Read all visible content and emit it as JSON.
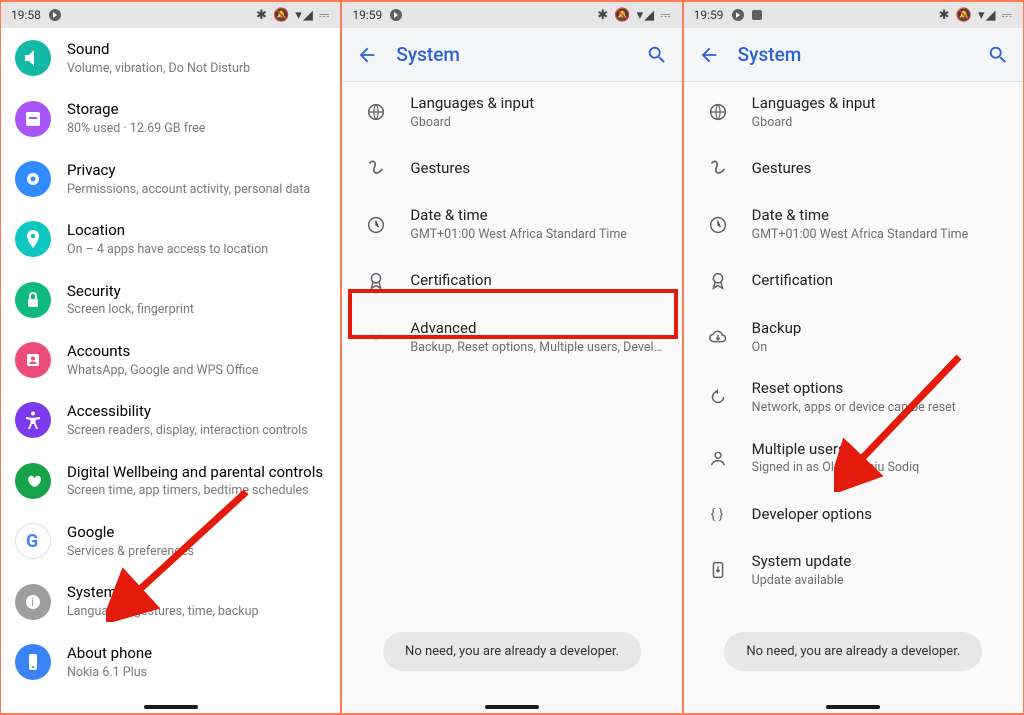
{
  "panel1": {
    "time": "19:58",
    "status_icons": "✱ 🔕 ▾◢ ⏻",
    "items": [
      {
        "key": "sound",
        "title": "Sound",
        "subtitle": "Volume, vibration, Do Not Disturb",
        "color": "#14b8a6",
        "icon": "volume"
      },
      {
        "key": "storage",
        "title": "Storage",
        "subtitle": "80% used · 12.69 GB free",
        "color": "#a855f7",
        "icon": "storage"
      },
      {
        "key": "privacy",
        "title": "Privacy",
        "subtitle": "Permissions, account activity, personal data",
        "color": "#2f8bff",
        "icon": "privacy"
      },
      {
        "key": "location",
        "title": "Location",
        "subtitle": "On – 4 apps have access to location",
        "color": "#0ec7c0",
        "icon": "location"
      },
      {
        "key": "security",
        "title": "Security",
        "subtitle": "Screen lock, fingerprint",
        "color": "#10b981",
        "icon": "lock"
      },
      {
        "key": "accounts",
        "title": "Accounts",
        "subtitle": "WhatsApp, Google and WPS Office",
        "color": "#ec4d78",
        "icon": "accounts"
      },
      {
        "key": "accessibility",
        "title": "Accessibility",
        "subtitle": "Screen readers, display, interaction controls",
        "color": "#7c3aed",
        "icon": "accessibility"
      },
      {
        "key": "wellbeing",
        "title": "Digital Wellbeing and parental controls",
        "subtitle": "Screen time, app timers, bedtime schedules",
        "color": "#16a34a",
        "icon": "wellbeing"
      },
      {
        "key": "google",
        "title": "Google",
        "subtitle": "Services & preferences",
        "color": "#ffffff",
        "icon": "google"
      },
      {
        "key": "system",
        "title": "System",
        "subtitle": "Languages, gestures, time, backup",
        "color": "#9e9e9e",
        "icon": "system"
      },
      {
        "key": "about",
        "title": "About phone",
        "subtitle": "Nokia 6.1 Plus",
        "color": "#3b82f6",
        "icon": "about"
      }
    ]
  },
  "panel2": {
    "time": "19:59",
    "appbar_title": "System",
    "items": [
      {
        "key": "lang",
        "title": "Languages & input",
        "subtitle": "Gboard",
        "icon": "globe"
      },
      {
        "key": "gest",
        "title": "Gestures",
        "subtitle": "",
        "icon": "gesture"
      },
      {
        "key": "datetime",
        "title": "Date & time",
        "subtitle": "GMT+01:00 West Africa Standard Time",
        "icon": "clock"
      },
      {
        "key": "cert",
        "title": "Certification",
        "subtitle": "",
        "icon": "badge"
      },
      {
        "key": "adv",
        "title": "Advanced",
        "subtitle": "Backup, Reset options, Multiple users, Developer o..",
        "icon": "chevron"
      }
    ],
    "toast": "No need, you are already a developer."
  },
  "panel3": {
    "time": "19:59",
    "appbar_title": "System",
    "items": [
      {
        "key": "lang",
        "title": "Languages & input",
        "subtitle": "Gboard",
        "icon": "globe"
      },
      {
        "key": "gest",
        "title": "Gestures",
        "subtitle": "",
        "icon": "gesture"
      },
      {
        "key": "datetime",
        "title": "Date & time",
        "subtitle": "GMT+01:00 West Africa Standard Time",
        "icon": "clock"
      },
      {
        "key": "cert",
        "title": "Certification",
        "subtitle": "",
        "icon": "badge"
      },
      {
        "key": "backup",
        "title": "Backup",
        "subtitle": "On",
        "icon": "cloud"
      },
      {
        "key": "reset",
        "title": "Reset options",
        "subtitle": "Network, apps or device can be reset",
        "icon": "reset"
      },
      {
        "key": "users",
        "title": "Multiple users",
        "subtitle": "Signed in as Olanrewaju Sodiq",
        "icon": "person"
      },
      {
        "key": "dev",
        "title": "Developer options",
        "subtitle": "",
        "icon": "braces"
      },
      {
        "key": "update",
        "title": "System update",
        "subtitle": "Update available",
        "icon": "update"
      }
    ],
    "toast": "No need, you are already a developer."
  }
}
